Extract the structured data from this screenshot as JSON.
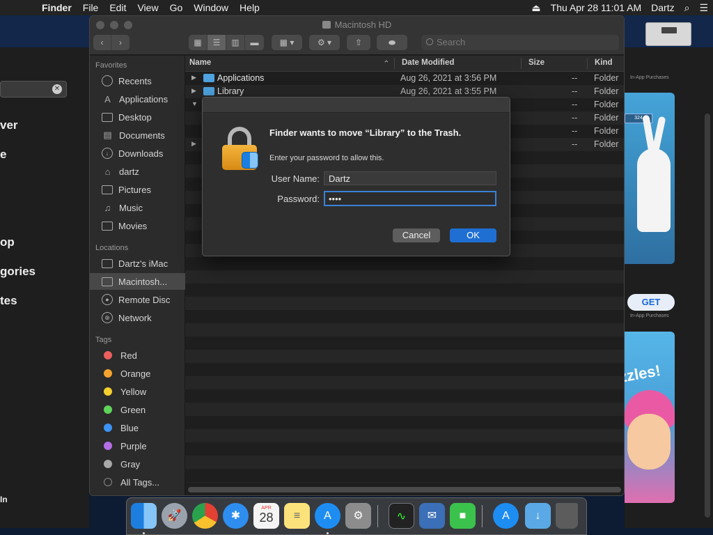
{
  "menubar": {
    "apple": "",
    "app": "Finder",
    "items": [
      "File",
      "Edit",
      "View",
      "Go",
      "Window",
      "Help"
    ],
    "datetime": "Thu Apr 28  11:01 AM",
    "user": "Dartz"
  },
  "window": {
    "title": "Macintosh HD",
    "search_placeholder": "Search"
  },
  "sidebar": {
    "favorites_header": "Favorites",
    "favorites": [
      "Recents",
      "Applications",
      "Desktop",
      "Documents",
      "Downloads",
      "dartz",
      "Pictures",
      "Music",
      "Movies"
    ],
    "locations_header": "Locations",
    "locations": [
      "Dartz's iMac",
      "Macintosh...",
      "Remote Disc",
      "Network"
    ],
    "tags_header": "Tags",
    "tags": [
      {
        "name": "Red",
        "color": "#ec5f5d"
      },
      {
        "name": "Orange",
        "color": "#f5a32f"
      },
      {
        "name": "Yellow",
        "color": "#f5d02e"
      },
      {
        "name": "Green",
        "color": "#5fd45a"
      },
      {
        "name": "Blue",
        "color": "#3c93f4"
      },
      {
        "name": "Purple",
        "color": "#b56ee6"
      },
      {
        "name": "Gray",
        "color": "#a8a8a8"
      }
    ],
    "all_tags": "All Tags..."
  },
  "columns": {
    "name": "Name",
    "date": "Date Modified",
    "size": "Size",
    "kind": "Kind"
  },
  "rows": [
    {
      "name": "Applications",
      "date": "Aug 26, 2021 at 3:56 PM",
      "size": "--",
      "kind": "Folder"
    },
    {
      "name": "Library",
      "date": "Aug 26, 2021 at 3:55 PM",
      "size": "--",
      "kind": "Folder"
    },
    {
      "name": "",
      "date": "",
      "size": "--",
      "kind": "Folder"
    },
    {
      "name": "",
      "date": "",
      "size": "--",
      "kind": "Folder"
    },
    {
      "name": "",
      "date": "",
      "size": "--",
      "kind": "Folder"
    },
    {
      "name": "",
      "date": "",
      "size": "--",
      "kind": "Folder"
    }
  ],
  "dialog": {
    "title": "Finder wants to move “Library” to the Trash.",
    "message": "Enter your password to allow this.",
    "username_label": "User Name:",
    "username_value": "Dartz",
    "password_label": "Password:",
    "password_value": "••••",
    "cancel": "Cancel",
    "ok": "OK"
  },
  "background_left": {
    "nav": [
      "ver",
      "e",
      "op",
      "gories",
      "tes"
    ],
    "bottom": "In"
  },
  "background_right": {
    "in_app_1": "In-App Purchases",
    "get": "GET",
    "in_app_2": "In-App Purchases",
    "art_word": "zzles!",
    "badge": "324"
  },
  "dock": {
    "calendar_month": "APR",
    "calendar_day": "28"
  }
}
